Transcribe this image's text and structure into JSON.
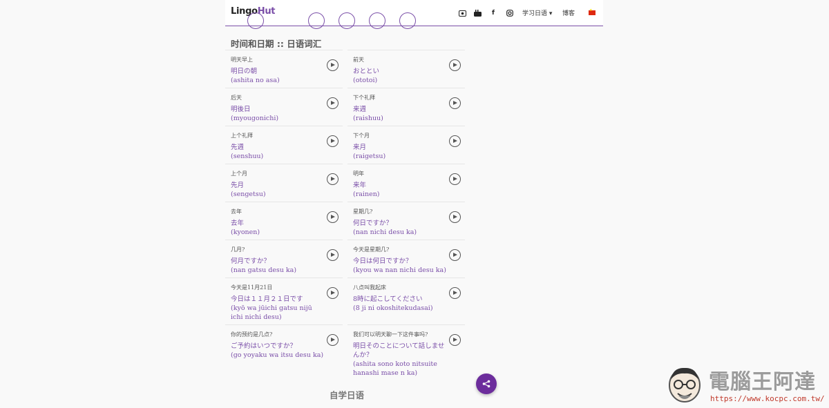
{
  "header": {
    "logo_main": "Lingo",
    "logo_accent": "Hut",
    "icons": [
      "video-icon",
      "youtube-icon",
      "facebook-icon",
      "instagram-icon"
    ],
    "learn_menu": "学习日语 ▾",
    "blog": "博客",
    "language_flag": "china-flag-icon"
  },
  "main": {
    "title": "时间和日期 :: 日语词汇",
    "words": [
      {
        "zh": "明天早上",
        "ja": "明日の朝",
        "romaji": "(ashita no asa)"
      },
      {
        "zh": "前天",
        "ja": "おととい",
        "romaji": "(ototoi)"
      },
      {
        "zh": "后天",
        "ja": "明後日",
        "romaji": "(myougonichi)"
      },
      {
        "zh": "下个礼拜",
        "ja": "来週",
        "romaji": "(raishuu)"
      },
      {
        "zh": "上个礼拜",
        "ja": "先週",
        "romaji": "(senshuu)"
      },
      {
        "zh": "下个月",
        "ja": "来月",
        "romaji": "(raigetsu)"
      },
      {
        "zh": "上个月",
        "ja": "先月",
        "romaji": "(sengetsu)"
      },
      {
        "zh": "明年",
        "ja": "来年",
        "romaji": "(rainen)"
      },
      {
        "zh": "去年",
        "ja": "去年",
        "romaji": "(kyonen)"
      },
      {
        "zh": "星期几?",
        "ja": "何日ですか？",
        "romaji": "(nan nichi desu ka)"
      },
      {
        "zh": "几月?",
        "ja": "何月ですか？",
        "romaji": "(nan gatsu desu ka)"
      },
      {
        "zh": "今天是星期几?",
        "ja": "今日は何日ですか？",
        "romaji": "(kyou wa nan nichi desu ka)"
      },
      {
        "zh": "今天是11月21日",
        "ja": "今日は１１月２１日です",
        "romaji": "(kyō wa jūichi gatsu nijū ichi nichi desu)"
      },
      {
        "zh": "八点叫我起床",
        "ja": "8時に起こしてください",
        "romaji": "(8 ji ni okoshitekudasai)"
      },
      {
        "zh": "你的预约是几点?",
        "ja": "ご予約はいつですか？",
        "romaji": "(go yoyaku wa itsu desu ka)"
      },
      {
        "zh": "我们可以明天聊一下这件事吗?",
        "ja": "明日そのことについて話しませんか？",
        "romaji": "(ashita sono koto nitsuite hanashi mase n ka)"
      }
    ],
    "next_section_title": "自学日语"
  },
  "share_button": "share-icon",
  "watermark": {
    "text": "電腦王阿達",
    "url": "https://www.kocpc.com.tw/"
  },
  "colors": {
    "accent": "#7a4ea8",
    "fab": "#6c2d9c",
    "background": "#f9f9f9"
  }
}
